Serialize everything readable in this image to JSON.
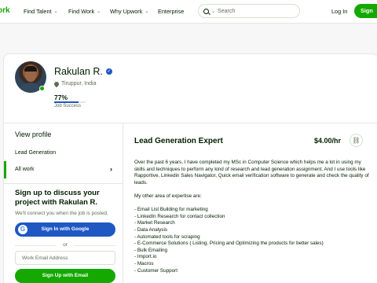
{
  "nav": {
    "logo": "ork",
    "links": [
      "Find Talent",
      "Find Work",
      "Why Upwork",
      "Enterprise"
    ],
    "search_placeholder": "Search",
    "login": "Log In",
    "signup": "Sign"
  },
  "profile": {
    "name": "Rakulan R.",
    "location": "Tiruppur, India",
    "job_success": "77%",
    "job_success_fraction": 0.77,
    "job_success_label": "Job Success"
  },
  "sidebar": {
    "title": "View profile",
    "items": [
      "Lead Generation",
      "All work"
    ],
    "signup_title": "Sign up to discuss your project with Rakulan R.",
    "signup_sub": "We'll connect you when the job is posted.",
    "google_button": "Sign In with Google",
    "or": "or",
    "email_placeholder": "Work Email Address",
    "email_button": "Sign Up with Email"
  },
  "main": {
    "title": "Lead Generation Expert",
    "rate": "$4.00/hr",
    "intro": "Over the past 6 years, I have completed my MSc in Computer Science which helps me a lot in using my skills and techniques to perform any kind of research and lead generation assignment. And I use tools like Rapportive, Linkedin Sales Navigator, Quick email verification software to generate and check the quality of leads.",
    "expertise_intro": "My other area of expertise are:",
    "skills": [
      "- Email List Building for marketing",
      "- LinkedIn Research for contact collection",
      "- Market Research",
      "- Data Analysis",
      "- Automated tools for scraping",
      "- E-Commerce Solutions ( Listing, Pricing and Optimizing the products for better sales)",
      "- Bulk Emailing",
      "- Import.io",
      "- Macros",
      "- Customer Support"
    ]
  },
  "colors": {
    "brand_green": "#14a800",
    "link_blue": "#1f57c3"
  }
}
